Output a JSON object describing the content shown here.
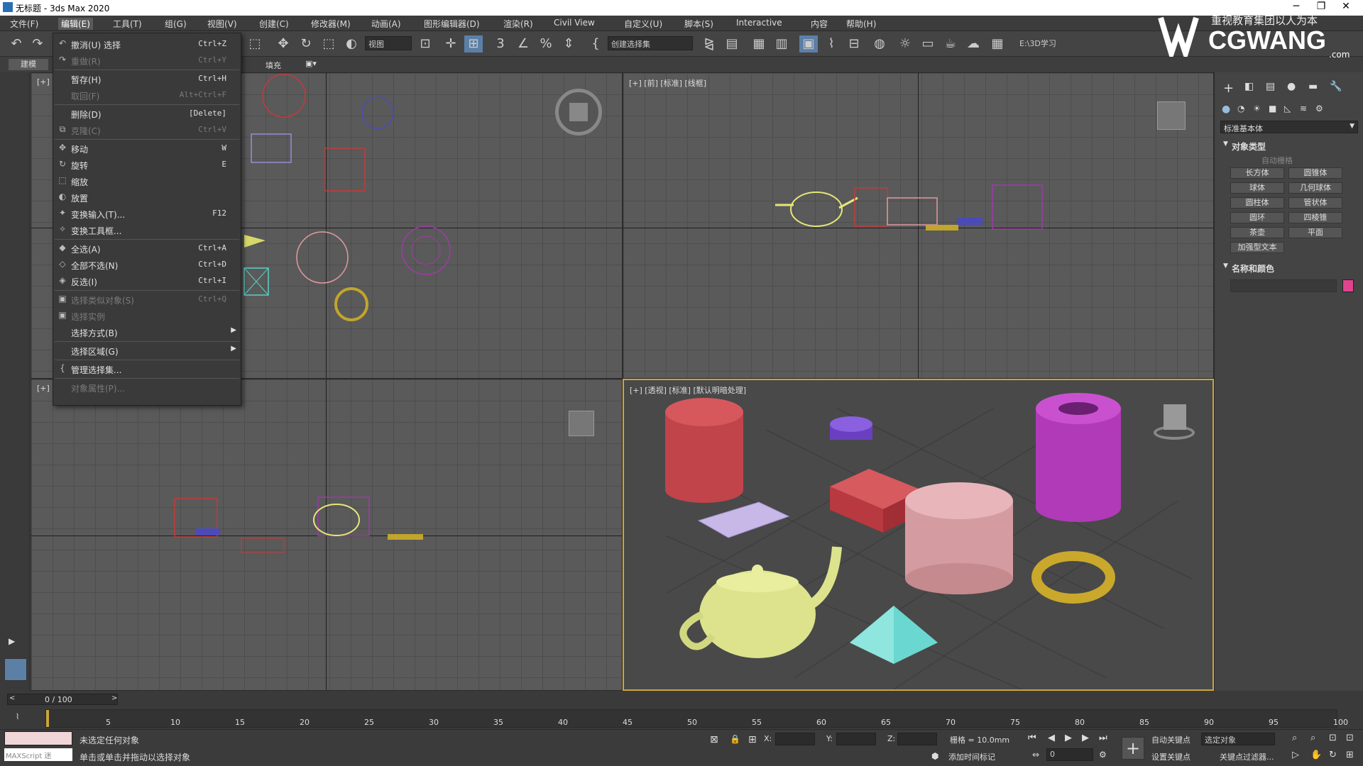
{
  "window": {
    "title": "无标题 - 3ds Max 2020",
    "minimize": "─",
    "maximize": "❐",
    "close": "✕"
  },
  "menubar": [
    "文件(F)",
    "编辑(E)",
    "工具(T)",
    "组(G)",
    "视图(V)",
    "创建(C)",
    "修改器(M)",
    "动画(A)",
    "图形编辑器(D)",
    "渲染(R)",
    "Civil View",
    "自定义(U)",
    "脚本(S)",
    "Interactive",
    "内容",
    "帮助(H)"
  ],
  "watermark": {
    "text": "CGWANG",
    "sub": ".com",
    "slogan": "重视教育集团以人为本"
  },
  "toolbar": {
    "view_select": "视图",
    "selset": "创建选择集",
    "path": "E:\\3D学习"
  },
  "ribbon": {
    "tab_label": "建模",
    "fill_label": "填充"
  },
  "edit_menu": [
    {
      "icon": "↶",
      "label": "撤消(U) 选择",
      "shortcut": "Ctrl+Z",
      "disabled": false
    },
    {
      "icon": "↷",
      "label": "重做(R)",
      "shortcut": "Ctrl+Y",
      "disabled": true
    },
    {
      "sep": true
    },
    {
      "icon": "",
      "label": "暂存(H)",
      "shortcut": "Ctrl+H",
      "disabled": false
    },
    {
      "icon": "",
      "label": "取回(F)",
      "shortcut": "Alt+Ctrl+F",
      "disabled": true
    },
    {
      "sep": true
    },
    {
      "icon": "",
      "label": "删除(D)",
      "shortcut": "[Delete]",
      "disabled": false
    },
    {
      "icon": "⧉",
      "label": "克隆(C)",
      "shortcut": "Ctrl+V",
      "disabled": true
    },
    {
      "sep": true
    },
    {
      "icon": "✥",
      "label": "移动",
      "shortcut": "W",
      "disabled": false
    },
    {
      "icon": "↻",
      "label": "旋转",
      "shortcut": "E",
      "disabled": false
    },
    {
      "icon": "⬚",
      "label": "缩放",
      "shortcut": "",
      "disabled": false
    },
    {
      "icon": "◐",
      "label": "放置",
      "shortcut": "",
      "disabled": false
    },
    {
      "icon": "✦",
      "label": "变换输入(T)...",
      "shortcut": "F12",
      "disabled": false
    },
    {
      "icon": "✧",
      "label": "变换工具框...",
      "shortcut": "",
      "disabled": false
    },
    {
      "sep": true
    },
    {
      "icon": "◆",
      "label": "全选(A)",
      "shortcut": "Ctrl+A",
      "disabled": false
    },
    {
      "icon": "◇",
      "label": "全部不选(N)",
      "shortcut": "Ctrl+D",
      "disabled": false
    },
    {
      "icon": "◈",
      "label": "反选(I)",
      "shortcut": "Ctrl+I",
      "disabled": false
    },
    {
      "sep": true
    },
    {
      "icon": "▣",
      "label": "选择类似对象(S)",
      "shortcut": "Ctrl+Q",
      "disabled": true
    },
    {
      "icon": "▣",
      "label": "选择实例",
      "shortcut": "",
      "disabled": true
    },
    {
      "icon": "",
      "label": "选择方式(B)",
      "shortcut": "",
      "submenu": true,
      "disabled": false
    },
    {
      "sep": true
    },
    {
      "icon": "",
      "label": "选择区域(G)",
      "shortcut": "",
      "submenu": true,
      "disabled": false
    },
    {
      "sep": true
    },
    {
      "icon": "{",
      "label": "管理选择集...",
      "shortcut": "",
      "disabled": false
    },
    {
      "sep": true
    },
    {
      "icon": "",
      "label": "对象属性(P)...",
      "shortcut": "",
      "disabled": true
    }
  ],
  "viewports": {
    "top_left": {
      "label": "[+]"
    },
    "top_right": {
      "label": "[+] [前] [标准] [线框]"
    },
    "bottom_left": {
      "label": "[+]"
    },
    "bottom_right": {
      "label": "[+] [透视] [标准] [默认明暗处理]"
    }
  },
  "command_panel": {
    "dropdown": "标准基本体",
    "section_object_type": "对象类型",
    "autogrid": "自动栅格",
    "buttons": [
      "长方体",
      "圆锥体",
      "球体",
      "几何球体",
      "圆柱体",
      "管状体",
      "圆环",
      "四棱锥",
      "茶壶",
      "平面",
      "加强型文本"
    ],
    "section_name_color": "名称和颜色",
    "color_swatch": "#e0448f"
  },
  "timeline": {
    "frame_counter": "0 / 100",
    "ticks": [
      "5",
      "10",
      "15",
      "20",
      "25",
      "30",
      "35",
      "40",
      "45",
      "50",
      "55",
      "60",
      "65",
      "70",
      "75",
      "80",
      "85",
      "90",
      "95",
      "100"
    ]
  },
  "status": {
    "maxscript": "MAXScript 迷",
    "line1": "未选定任何对象",
    "line2": "单击或单击并拖动以选择对象",
    "x_label": "X:",
    "y_label": "Y:",
    "z_label": "Z:",
    "grid": "栅格 = 10.0mm",
    "add_time_tag": "添加时间标记",
    "auto_key": "自动关键点",
    "selected_object": "选定对象",
    "set_key": "设置关键点",
    "key_filter": "关键点过滤器...",
    "frame_value": "0"
  }
}
